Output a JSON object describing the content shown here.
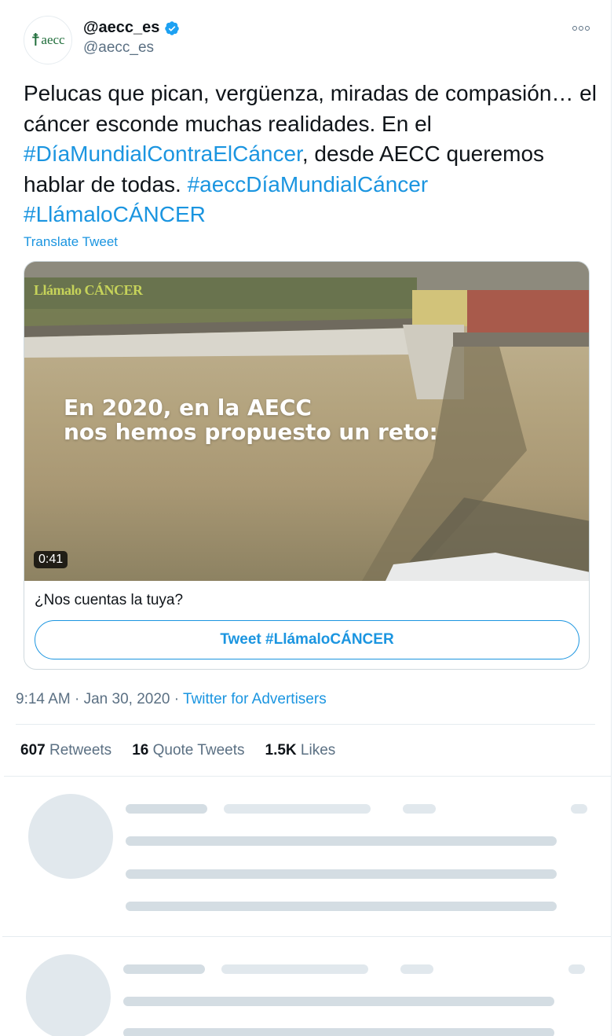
{
  "tweet": {
    "display_name": "@aecc_es",
    "handle": "@aecc_es",
    "avatar_logo_text": "aecc",
    "text_parts": [
      {
        "text": "Pelucas que pican, vergüenza, miradas de compasión… el cáncer esconde muchas realidades. En el ",
        "type": "text"
      },
      {
        "text": "#DíaMundialContraElCáncer",
        "type": "hashtag"
      },
      {
        "text": ", desde AECC queremos hablar de todas. ",
        "type": "text"
      },
      {
        "text": "#aeccDíaMundialCáncer",
        "type": "hashtag"
      },
      {
        "text": " ",
        "type": "text"
      },
      {
        "text": "#LlámaloCÁNCER",
        "type": "hashtag"
      }
    ],
    "translate_label": "Translate Tweet"
  },
  "card": {
    "video_watermark": "Llámalo CÁNCER",
    "video_overlay_line1": "En 2020, en la AECC",
    "video_overlay_line2": "nos hemos propuesto un reto:",
    "duration": "0:41",
    "caption": "¿Nos cuentas la tuya?",
    "button_label": "Tweet #LlámaloCÁNCER"
  },
  "meta": {
    "time": "9:14 AM",
    "date": "Jan 30, 2020",
    "separator": "·",
    "source": "Twitter for Advertisers"
  },
  "stats": {
    "retweets_count": "607",
    "retweets_label": "Retweets",
    "quotes_count": "16",
    "quotes_label": "Quote Tweets",
    "likes_count": "1.5K",
    "likes_label": "Likes"
  },
  "colors": {
    "link": "#1b95e0",
    "secondary_text": "#5b7083",
    "border": "#e6ecf0",
    "verified": "#1da1f2"
  }
}
